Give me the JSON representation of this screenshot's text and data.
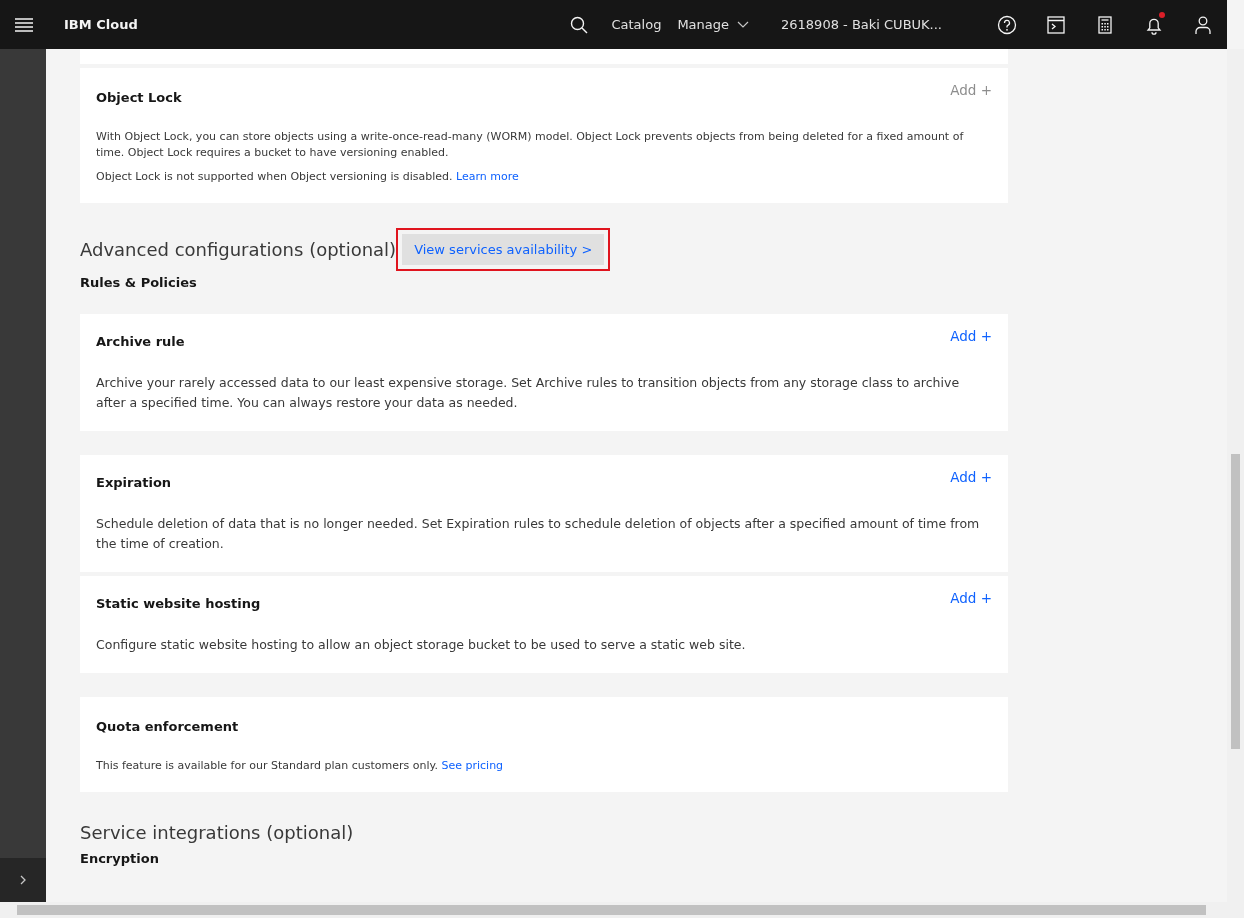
{
  "header": {
    "brand": "IBM Cloud",
    "nav": [
      {
        "label": "Catalog",
        "dropdown": false
      },
      {
        "label": "Manage",
        "dropdown": true
      }
    ],
    "account": "2618908 - Baki CUBUK...",
    "notifications_unread": true
  },
  "top_cards": [
    {
      "title": "Object Lock",
      "add": {
        "label": "Add +",
        "disabled": true
      },
      "kind": "compact",
      "paragraphs": [
        {
          "text": "With Object Lock, you can store objects using a write-once-read-many (WORM) model. Object Lock prevents objects from being deleted for a fixed amount of time. Object Lock requires a bucket to have versioning enabled."
        },
        {
          "text": "Object Lock is not supported when Object versioning is disabled.",
          "link": "Learn more"
        }
      ]
    }
  ],
  "advanced": {
    "heading": "Advanced configurations (optional)",
    "button": "View services availability >",
    "highlighted": true,
    "subheading": "Rules & Policies"
  },
  "rule_groups": [
    {
      "cards": [
        {
          "title": "Archive rule",
          "add": {
            "label": "Add +",
            "disabled": false
          },
          "kind": "regular",
          "paragraphs": [
            {
              "text": "Archive your rarely accessed data to our least expensive storage. Set Archive rules to transition objects from any storage class to archive after a specified time. You can always restore your data as needed."
            }
          ]
        }
      ]
    },
    {
      "cards": [
        {
          "title": "Expiration",
          "add": {
            "label": "Add +",
            "disabled": false
          },
          "kind": "regular",
          "paragraphs": [
            {
              "text": "Schedule deletion of data that is no longer needed. Set Expiration rules to schedule deletion of objects after a specified amount of time from the time of creation."
            }
          ]
        },
        {
          "title": "Static website hosting",
          "add": {
            "label": "Add +",
            "disabled": false
          },
          "kind": "regular",
          "paragraphs": [
            {
              "text": "Configure static website hosting to allow an object storage bucket to be used to serve a static web site."
            }
          ]
        }
      ]
    },
    {
      "cards": [
        {
          "title": "Quota enforcement",
          "kind": "compact",
          "paragraphs": [
            {
              "text": "This feature is available for our Standard plan customers only.",
              "link": "See pricing"
            }
          ]
        }
      ]
    }
  ],
  "integrations": {
    "heading": "Service integrations (optional)",
    "subheading": "Encryption"
  }
}
